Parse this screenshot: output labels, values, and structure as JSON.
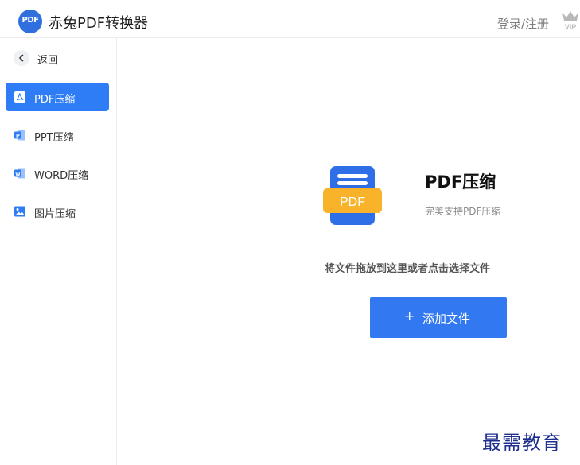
{
  "header": {
    "logo_text": "PDF",
    "title": "赤兔PDF转换器",
    "login_label": "登录/注册",
    "vip_label": "VIP"
  },
  "sidebar": {
    "back_label": "返回",
    "items": [
      {
        "label": "PDF压缩",
        "icon": "pdf-icon",
        "active": true
      },
      {
        "label": "PPT压缩",
        "icon": "ppt-icon",
        "active": false
      },
      {
        "label": "WORD压缩",
        "icon": "word-icon",
        "active": false
      },
      {
        "label": "图片压缩",
        "icon": "image-icon",
        "active": false
      }
    ]
  },
  "main": {
    "feature_title": "PDF压缩",
    "feature_subtitle": "完美支持PDF压缩",
    "doc_badge": "PDF",
    "drop_hint": "将文件拖放到这里或者点击选择文件",
    "add_button_plus": "+",
    "add_button_label": "添加文件"
  },
  "watermark": "最需教育",
  "colors": {
    "accent": "#2e7df6",
    "button": "#3278f0",
    "badge": "#f8b32b",
    "logo": "#2f6fde",
    "watermark": "#1f2f8f"
  }
}
